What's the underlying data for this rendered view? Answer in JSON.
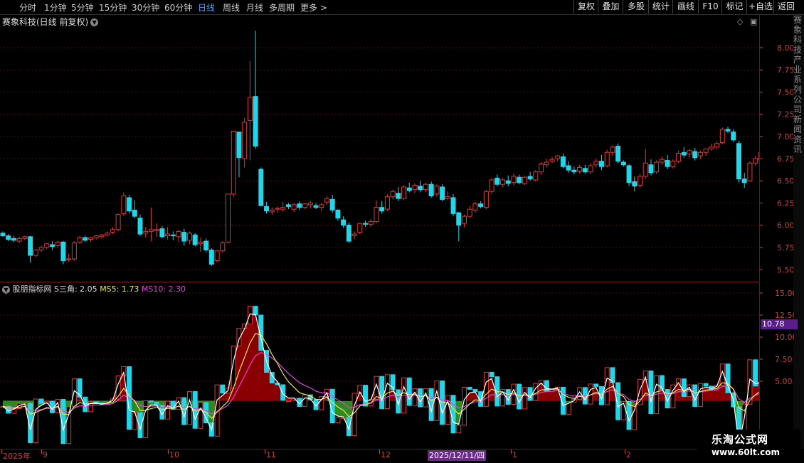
{
  "toolbar": {
    "periods": [
      "分时",
      "1分钟",
      "5分钟",
      "15分钟",
      "30分钟",
      "60分钟",
      "日线",
      "周线",
      "月线",
      "多周期",
      "更多 >"
    ],
    "active_period": "日线",
    "buttons": [
      "复权",
      "叠加",
      "多股",
      "统计",
      "画线",
      "F10",
      "标记",
      "+自选",
      "返回"
    ]
  },
  "main_panel": {
    "title": "赛象科技(日线 前复权)",
    "price_ticks": [
      "8.00",
      "7.75",
      "7.50",
      "7.25",
      "7.00",
      "6.75",
      "6.50",
      "6.25",
      "6.00",
      "5.75",
      "5.50"
    ]
  },
  "indicator_panel": {
    "name": "股朋指标网",
    "s_label": "S三角: 2.05",
    "ms5_label": "MS5: 1.73",
    "ms10_label": "MS10: 2.30",
    "ticks": [
      "15.00",
      "12.50",
      "10.00",
      "7.50",
      "5.00"
    ],
    "current_value": "10.78"
  },
  "date_axis": {
    "labels": [
      "2025年",
      "9",
      "10",
      "11",
      "12",
      "1",
      "2"
    ],
    "cursor_date": "2025/12/11/四"
  },
  "watermark": {
    "line1": "乐淘公式网",
    "line2": "www.60lt.com"
  },
  "side_strip_text": "赛象科技产业系列公司新闻资讯",
  "colors": {
    "up": "#e23838",
    "down": "#23d5e8",
    "ms5": "#e8e850",
    "ms10": "#e040e0",
    "s_line": "#ffffff",
    "fill_up": "#8a0000",
    "fill_down": "#2e8a20"
  },
  "chart_data": {
    "type": "candlestick",
    "ohlc": [
      [
        5.91,
        5.93,
        5.88,
        5.87
      ],
      [
        5.88,
        5.9,
        5.84,
        5.82
      ],
      [
        5.85,
        5.88,
        5.83,
        5.81
      ],
      [
        5.82,
        5.87,
        5.85,
        5.8
      ],
      [
        5.85,
        5.88,
        5.87,
        5.83
      ],
      [
        5.87,
        5.88,
        5.66,
        5.58
      ],
      [
        5.66,
        5.73,
        5.72,
        5.64
      ],
      [
        5.72,
        5.77,
        5.75,
        5.7
      ],
      [
        5.75,
        5.8,
        5.79,
        5.73
      ],
      [
        5.78,
        5.82,
        5.76,
        5.72
      ],
      [
        5.77,
        5.82,
        5.81,
        5.75
      ],
      [
        5.81,
        5.82,
        5.6,
        5.56
      ],
      [
        5.61,
        5.68,
        5.62,
        5.59
      ],
      [
        5.62,
        5.82,
        5.8,
        5.6
      ],
      [
        5.81,
        5.88,
        5.86,
        5.79
      ],
      [
        5.86,
        5.88,
        5.83,
        5.81
      ],
      [
        5.84,
        5.87,
        5.86,
        5.81
      ],
      [
        5.86,
        5.89,
        5.88,
        5.84
      ],
      [
        5.87,
        5.9,
        5.89,
        5.85
      ],
      [
        5.89,
        5.93,
        5.91,
        5.88
      ],
      [
        5.92,
        5.98,
        5.95,
        5.9
      ],
      [
        5.95,
        6.13,
        6.12,
        5.93
      ],
      [
        6.13,
        6.37,
        6.33,
        6.1
      ],
      [
        6.31,
        6.34,
        6.16,
        6.13
      ],
      [
        6.17,
        6.28,
        6.1,
        6.08
      ],
      [
        6.08,
        6.12,
        5.9,
        5.88
      ],
      [
        5.91,
        5.98,
        5.93,
        5.86
      ],
      [
        5.93,
        6.2,
        5.95,
        5.82
      ],
      [
        5.94,
        6.02,
        5.95,
        5.87
      ],
      [
        5.96,
        5.99,
        5.87,
        5.85
      ],
      [
        5.88,
        5.98,
        5.9,
        5.84
      ],
      [
        5.89,
        5.93,
        5.88,
        5.83
      ],
      [
        5.87,
        5.95,
        5.93,
        5.81
      ],
      [
        5.92,
        5.96,
        5.82,
        5.77
      ],
      [
        5.83,
        5.93,
        5.91,
        5.79
      ],
      [
        5.89,
        5.91,
        5.78,
        5.76
      ],
      [
        5.79,
        5.86,
        5.81,
        5.7
      ],
      [
        5.82,
        5.85,
        5.72,
        5.69
      ],
      [
        5.72,
        5.74,
        5.56,
        5.54
      ],
      [
        5.6,
        5.72,
        5.71,
        5.58
      ],
      [
        5.71,
        5.82,
        5.8,
        5.69
      ],
      [
        5.81,
        6.35,
        6.35,
        5.8
      ],
      [
        6.35,
        7.06,
        7.06,
        6.32
      ],
      [
        7.05,
        6.95,
        6.76,
        6.54
      ],
      [
        6.75,
        7.21,
        7.16,
        6.65
      ],
      [
        7.18,
        7.85,
        7.44,
        6.73
      ],
      [
        7.45,
        8.19,
        6.89,
        6.86
      ],
      [
        6.63,
        6.65,
        6.22,
        6.22
      ],
      [
        6.21,
        6.26,
        6.16,
        6.13
      ],
      [
        6.15,
        6.2,
        6.17,
        6.12
      ],
      [
        6.18,
        6.21,
        6.19,
        6.14
      ],
      [
        6.18,
        6.26,
        6.2,
        6.15
      ],
      [
        6.23,
        6.25,
        6.21,
        6.18
      ],
      [
        6.18,
        6.25,
        6.23,
        6.15
      ],
      [
        6.24,
        6.27,
        6.2,
        6.17
      ],
      [
        6.2,
        6.25,
        6.24,
        6.18
      ],
      [
        6.23,
        6.27,
        6.25,
        6.19
      ],
      [
        6.22,
        6.25,
        6.2,
        6.18
      ],
      [
        6.2,
        6.25,
        6.23,
        6.16
      ],
      [
        6.26,
        6.33,
        6.3,
        6.22
      ],
      [
        6.29,
        6.34,
        6.17,
        6.14
      ],
      [
        6.17,
        6.18,
        6.08,
        6.05
      ],
      [
        6.06,
        6.1,
        6.0,
        5.97
      ],
      [
        6.0,
        6.03,
        5.82,
        5.8
      ],
      [
        5.88,
        5.93,
        5.9,
        5.84
      ],
      [
        5.92,
        6.03,
        6.02,
        5.9
      ],
      [
        6.02,
        6.05,
        6.01,
        5.98
      ],
      [
        6.01,
        6.07,
        6.04,
        5.98
      ],
      [
        6.04,
        6.28,
        6.2,
        6.02
      ],
      [
        6.2,
        6.27,
        6.16,
        6.13
      ],
      [
        6.18,
        6.35,
        6.32,
        6.16
      ],
      [
        6.32,
        6.4,
        6.38,
        6.29
      ],
      [
        6.36,
        6.43,
        6.3,
        6.27
      ],
      [
        6.3,
        6.45,
        6.43,
        6.28
      ],
      [
        6.42,
        6.48,
        6.39,
        6.37
      ],
      [
        6.4,
        6.47,
        6.45,
        6.36
      ],
      [
        6.44,
        6.5,
        6.4,
        6.37
      ],
      [
        6.4,
        6.48,
        6.46,
        6.37
      ],
      [
        6.46,
        6.49,
        6.33,
        6.31
      ],
      [
        6.35,
        6.46,
        6.44,
        6.32
      ],
      [
        6.43,
        6.46,
        6.29,
        6.27
      ],
      [
        6.3,
        6.38,
        6.32,
        6.28
      ],
      [
        6.31,
        6.35,
        6.13,
        6.1
      ],
      [
        6.14,
        6.15,
        6.0,
        5.82
      ],
      [
        6.02,
        6.12,
        6.1,
        5.98
      ],
      [
        6.1,
        6.22,
        6.18,
        6.08
      ],
      [
        6.17,
        6.26,
        6.24,
        6.14
      ],
      [
        6.24,
        6.27,
        6.21,
        6.19
      ],
      [
        6.2,
        6.4,
        6.38,
        6.18
      ],
      [
        6.38,
        6.53,
        6.51,
        6.35
      ],
      [
        6.53,
        6.57,
        6.46,
        6.44
      ],
      [
        6.46,
        6.53,
        6.51,
        6.43
      ],
      [
        6.5,
        6.56,
        6.47,
        6.44
      ],
      [
        6.48,
        6.58,
        6.55,
        6.45
      ],
      [
        6.54,
        6.57,
        6.48,
        6.46
      ],
      [
        6.47,
        6.56,
        6.54,
        6.45
      ],
      [
        6.55,
        6.6,
        6.52,
        6.5
      ],
      [
        6.51,
        6.62,
        6.6,
        6.49
      ],
      [
        6.6,
        6.71,
        6.69,
        6.57
      ],
      [
        6.68,
        6.75,
        6.71,
        6.65
      ],
      [
        6.72,
        6.77,
        6.74,
        6.7
      ],
      [
        6.75,
        6.79,
        6.78,
        6.72
      ],
      [
        6.77,
        6.81,
        6.66,
        6.64
      ],
      [
        6.67,
        6.72,
        6.62,
        6.59
      ],
      [
        6.62,
        6.66,
        6.6,
        6.57
      ],
      [
        6.61,
        6.68,
        6.65,
        6.58
      ],
      [
        6.64,
        6.68,
        6.6,
        6.58
      ],
      [
        6.6,
        6.7,
        6.67,
        6.58
      ],
      [
        6.68,
        6.75,
        6.72,
        6.65
      ],
      [
        6.72,
        6.79,
        6.66,
        6.62
      ],
      [
        6.67,
        6.85,
        6.82,
        6.65
      ],
      [
        6.82,
        6.9,
        6.88,
        6.78
      ],
      [
        6.89,
        6.92,
        6.72,
        6.7
      ],
      [
        6.71,
        6.73,
        6.68,
        6.66
      ],
      [
        6.67,
        6.69,
        6.48,
        6.44
      ],
      [
        6.49,
        6.55,
        6.44,
        6.38
      ],
      [
        6.45,
        6.58,
        6.55,
        6.42
      ],
      [
        6.55,
        6.86,
        6.7,
        6.52
      ],
      [
        6.68,
        6.74,
        6.59,
        6.56
      ],
      [
        6.6,
        6.73,
        6.71,
        6.58
      ],
      [
        6.71,
        6.77,
        6.74,
        6.68
      ],
      [
        6.73,
        6.79,
        6.66,
        6.63
      ],
      [
        6.66,
        6.74,
        6.72,
        6.64
      ],
      [
        6.72,
        6.84,
        6.81,
        6.7
      ],
      [
        6.82,
        6.88,
        6.79,
        6.76
      ],
      [
        6.8,
        6.86,
        6.84,
        6.76
      ],
      [
        6.83,
        6.87,
        6.76,
        6.73
      ],
      [
        6.78,
        6.84,
        6.82,
        6.75
      ],
      [
        6.82,
        6.86,
        6.86,
        6.78
      ],
      [
        6.86,
        6.92,
        6.88,
        6.84
      ],
      [
        6.88,
        6.95,
        6.92,
        6.85
      ],
      [
        6.93,
        7.1,
        7.08,
        6.91
      ],
      [
        7.08,
        7.11,
        7.06,
        7.04
      ],
      [
        7.05,
        7.08,
        6.96,
        6.94
      ],
      [
        6.92,
        6.95,
        6.52,
        6.48
      ],
      [
        6.52,
        6.59,
        6.48,
        6.42
      ],
      [
        6.5,
        6.72,
        6.7,
        6.49
      ],
      [
        6.7,
        6.78,
        6.75,
        6.67
      ],
      [
        6.74,
        6.84,
        6.82,
        6.72
      ],
      [
        6.74,
        6.86,
        6.84,
        6.71
      ],
      [
        6.85,
        7.05,
        7.02,
        6.83
      ]
    ]
  }
}
